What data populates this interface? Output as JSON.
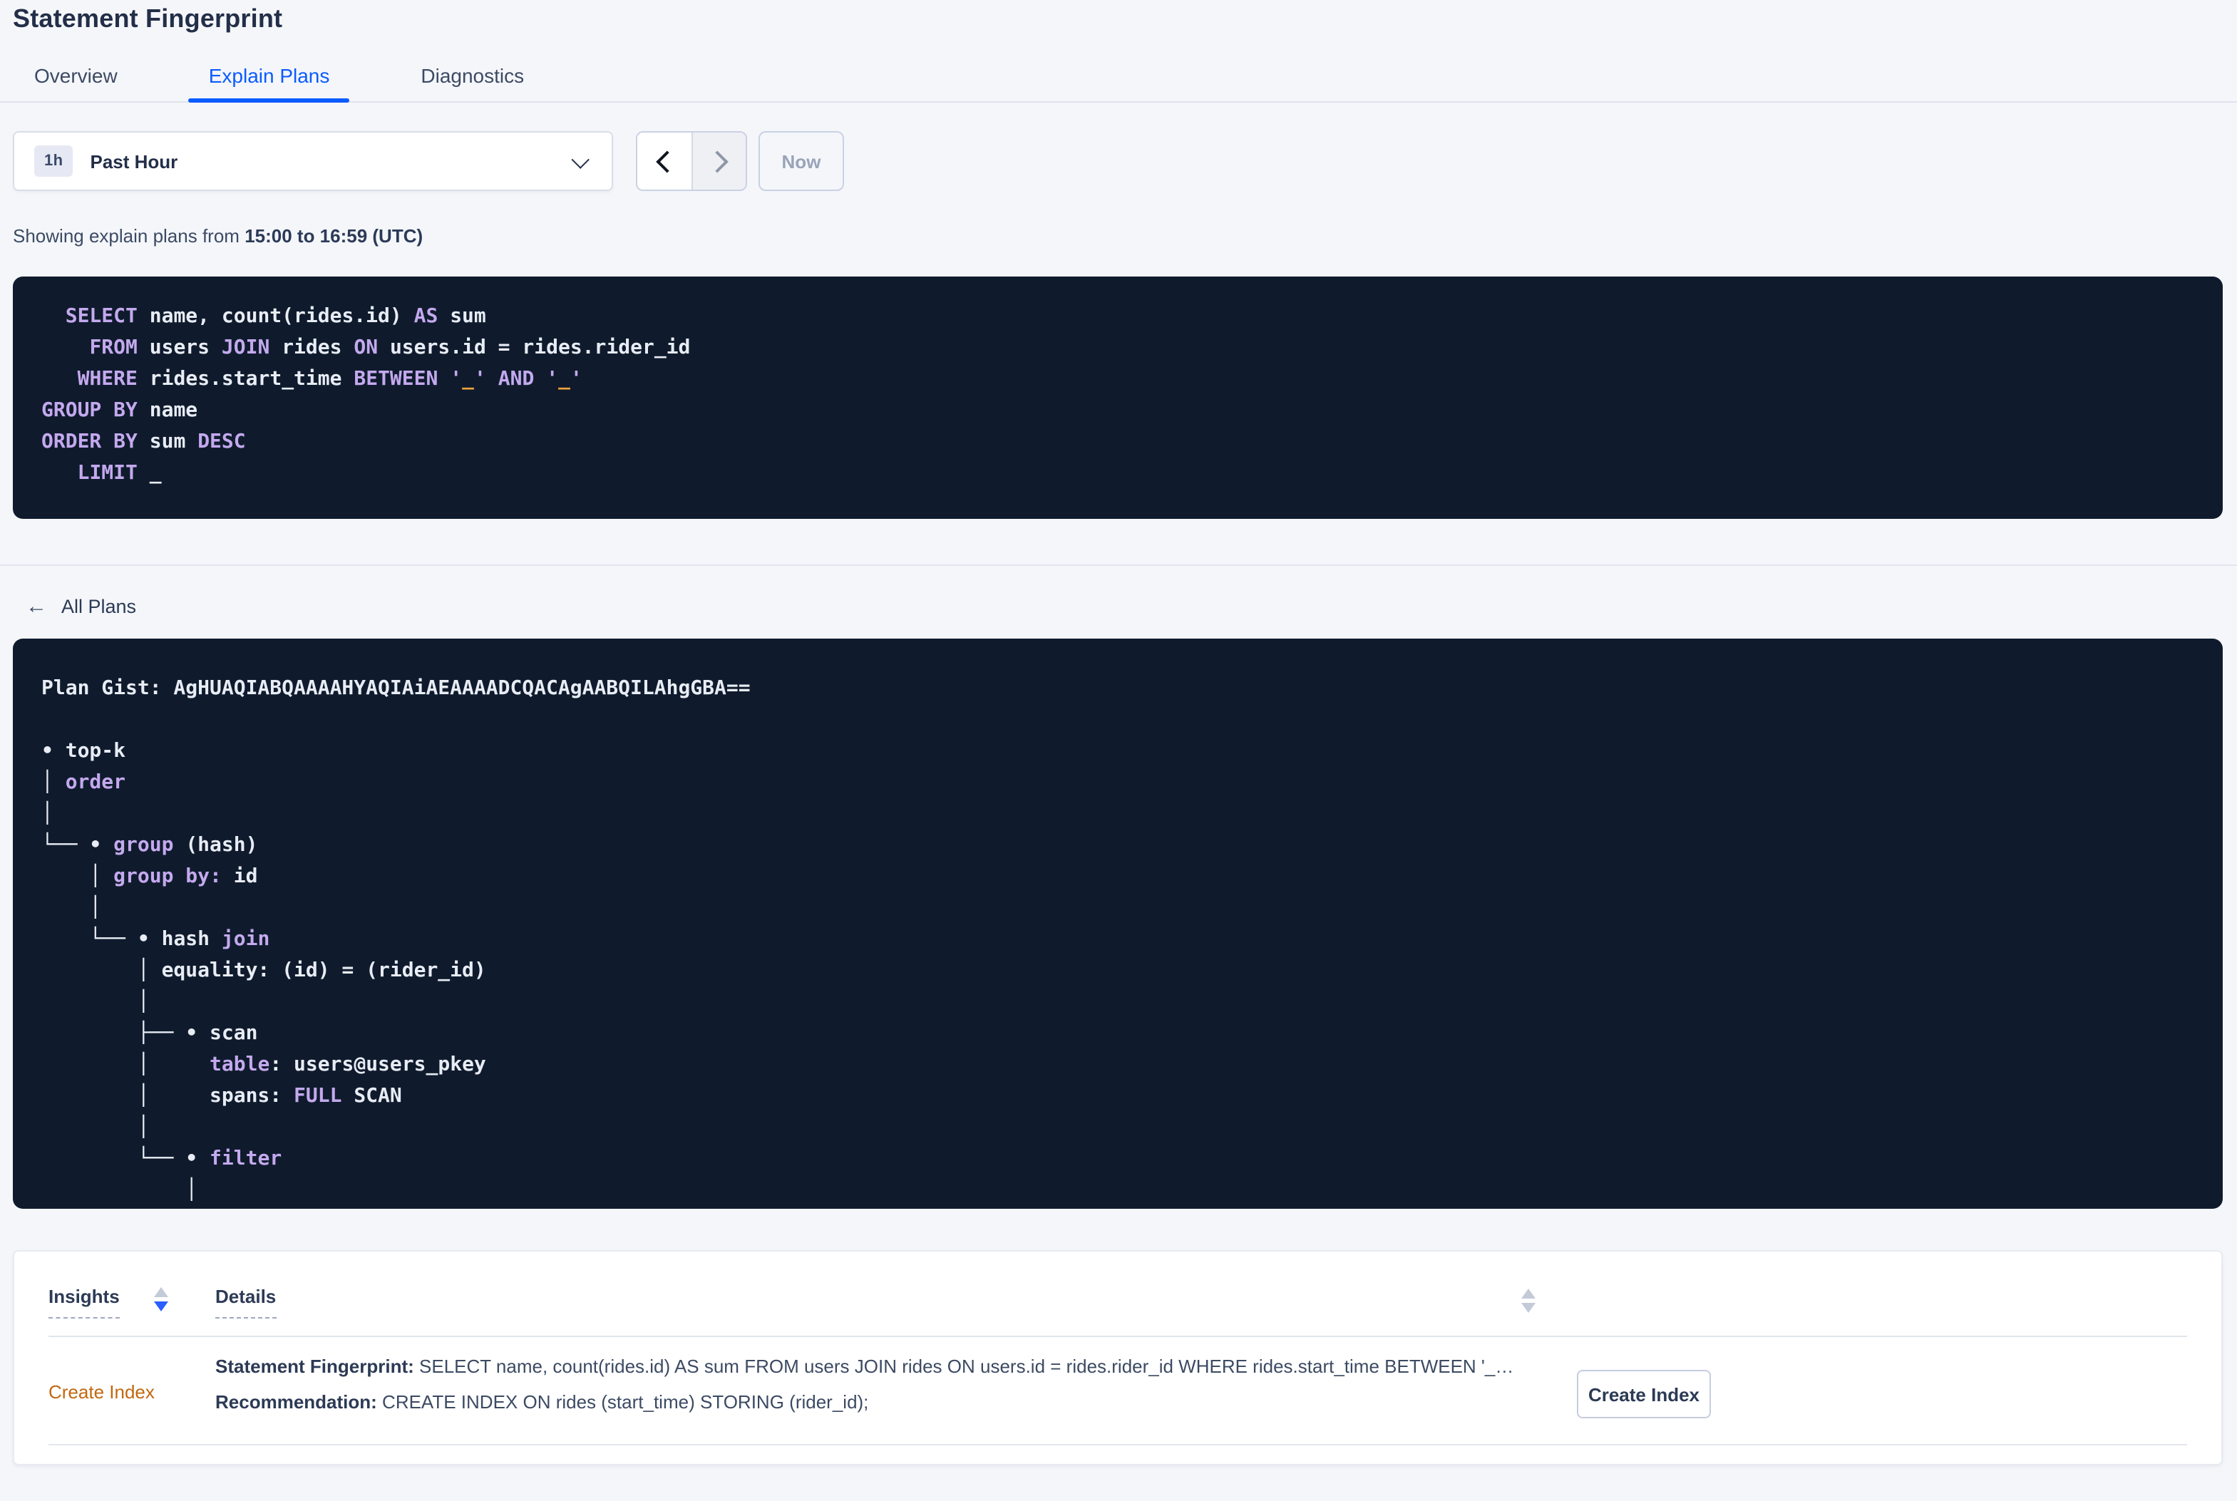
{
  "header": {
    "title": "Statement Fingerprint"
  },
  "tabs": [
    {
      "label": "Overview",
      "active": false
    },
    {
      "label": "Explain Plans",
      "active": true
    },
    {
      "label": "Diagnostics",
      "active": false
    }
  ],
  "time_controls": {
    "interval_badge": "1h",
    "selected_range": "Past Hour",
    "now_label": "Now"
  },
  "status_line": {
    "prefix": "Showing explain plans from ",
    "range_bold": "15:00 to 16:59 (UTC)"
  },
  "sql_preview": {
    "lines": [
      [
        [
          "  ",
          "w"
        ],
        [
          "SELECT",
          "k"
        ],
        [
          " name, count(rides.id) ",
          "w"
        ],
        [
          "AS",
          "k"
        ],
        [
          " sum",
          "w"
        ]
      ],
      [
        [
          "    ",
          "w"
        ],
        [
          "FROM",
          "k"
        ],
        [
          " users ",
          "w"
        ],
        [
          "JOIN",
          "k"
        ],
        [
          " rides ",
          "w"
        ],
        [
          "ON",
          "k"
        ],
        [
          " users.id = rides.rider_id",
          "w"
        ]
      ],
      [
        [
          "   ",
          "w"
        ],
        [
          "WHERE",
          "k"
        ],
        [
          " rides.start_time ",
          "w"
        ],
        [
          "BETWEEN",
          "k"
        ],
        [
          " ",
          "w"
        ],
        [
          "'",
          "k"
        ],
        [
          "_",
          "o"
        ],
        [
          "'",
          "k"
        ],
        [
          " ",
          "w"
        ],
        [
          "AND",
          "k"
        ],
        [
          " ",
          "w"
        ],
        [
          "'",
          "k"
        ],
        [
          "_",
          "o"
        ],
        [
          "'",
          "k"
        ]
      ],
      [
        [
          "GROUP BY",
          "k"
        ],
        [
          " name",
          "w"
        ]
      ],
      [
        [
          "ORDER BY",
          "k"
        ],
        [
          " sum ",
          "w"
        ],
        [
          "DESC",
          "k"
        ]
      ],
      [
        [
          "   ",
          "w"
        ],
        [
          "LIMIT",
          "k"
        ],
        [
          " _",
          "w"
        ]
      ]
    ]
  },
  "plans_nav": {
    "back_label": "All Plans",
    "back_arrow": "←"
  },
  "plan_detail": {
    "gist": "AgHUAQIABQAAAAHYAQIAiAEAAAADCQACAgAABQILAhgGBA==",
    "lines": [
      [
        [
          "Plan Gist: AgHUAQIABQAAAAHYAQIAiAEAAAADCQACAgAABQILAhgGBA==",
          "w"
        ]
      ],
      [],
      [
        [
          "• ",
          "w"
        ],
        [
          "top-k",
          "w"
        ]
      ],
      [
        [
          "│ ",
          "w"
        ],
        [
          "order",
          "k"
        ]
      ],
      [
        [
          "│",
          "w"
        ]
      ],
      [
        [
          "└── • ",
          "w"
        ],
        [
          "group",
          "k"
        ],
        [
          " (hash)",
          "w"
        ]
      ],
      [
        [
          "    │ ",
          "w"
        ],
        [
          "group by:",
          "k"
        ],
        [
          " id",
          "w"
        ]
      ],
      [
        [
          "    │",
          "w"
        ]
      ],
      [
        [
          "    └── • ",
          "w"
        ],
        [
          "hash ",
          "w"
        ],
        [
          "join",
          "k"
        ]
      ],
      [
        [
          "        │ equality: (id) = (rider_id)",
          "w"
        ]
      ],
      [
        [
          "        │",
          "w"
        ]
      ],
      [
        [
          "        ├── • ",
          "w"
        ],
        [
          "scan",
          "w"
        ]
      ],
      [
        [
          "        │     ",
          "w"
        ],
        [
          "table",
          "k"
        ],
        [
          ": users@users_pkey",
          "w"
        ]
      ],
      [
        [
          "        │     spans: ",
          "w"
        ],
        [
          "FULL",
          "k"
        ],
        [
          " SCAN",
          "w"
        ]
      ],
      [
        [
          "        │",
          "w"
        ]
      ],
      [
        [
          "        └── • ",
          "w"
        ],
        [
          "filter",
          "k"
        ]
      ],
      [
        [
          "            │",
          "w"
        ]
      ]
    ]
  },
  "insights_table": {
    "columns": {
      "insights": "Insights",
      "details": "Details"
    },
    "rows": [
      {
        "insight_link": "Create Index",
        "fingerprint_label": "Statement Fingerprint:",
        "fingerprint_text": " SELECT name, count(rides.id) AS sum FROM users JOIN rides ON users.id = rides.rider_id WHERE rides.start_time BETWEEN '_…",
        "recommendation_label": "Recommendation:",
        "recommendation_text": " CREATE INDEX ON rides (start_time) STORING (rider_id);",
        "action_button": "Create Index"
      }
    ]
  },
  "colors": {
    "accent_blue": "#0b5bff",
    "code_background": "#0f1b2d",
    "code_keyword_purple": "#c4a9ee",
    "code_literal_orange": "#f6a23b",
    "code_text_white": "#e8ecf4",
    "insight_link_orange": "#c2680f",
    "sort_active_blue": "#2b5eff",
    "page_background": "#f4f6fa"
  }
}
